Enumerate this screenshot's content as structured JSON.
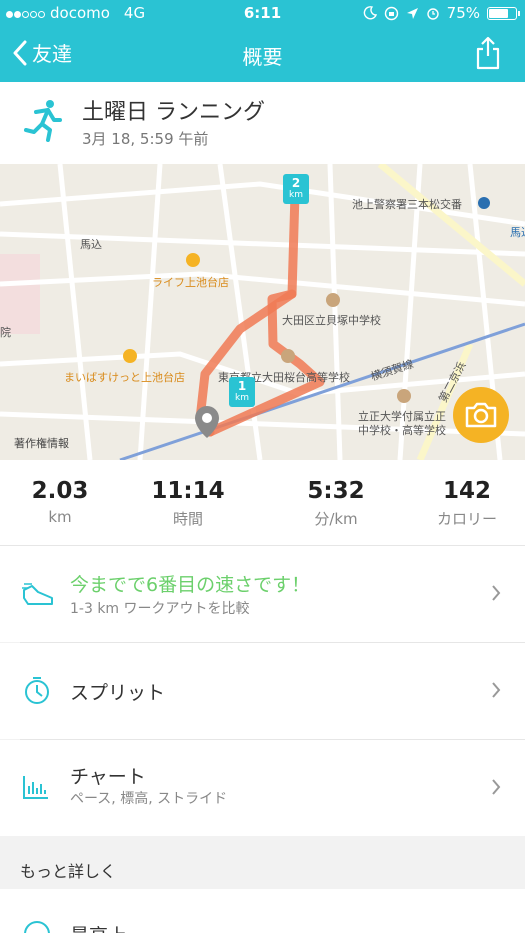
{
  "status_bar": {
    "carrier": "docomo",
    "network": "4G",
    "time": "6:11",
    "battery": "75%",
    "battery_level": 0.75
  },
  "nav": {
    "back_label": "友達",
    "title": "概要"
  },
  "activity": {
    "title": "土曜日 ランニング",
    "date": "3月 18, 5:59 午前"
  },
  "map": {
    "labels": {
      "station": "池上警察署三本松交番",
      "magome": "馬込",
      "umagome_right": "馬込",
      "life": "ライフ上池台店",
      "school1": "大田区立貝塚中学校",
      "school2": "東京都立大田桜台高等学校",
      "maibasu": "まいばすけっと上池台店",
      "yokosuka": "横須賀線",
      "daini": "第二京浜",
      "rissho1": "立正大学付属立正",
      "rissho2": "中学校・高等学校",
      "in": "院",
      "copyright": "著作権情報",
      "km1": "1",
      "km2": "2",
      "km_unit": "km"
    }
  },
  "stats": [
    {
      "value": "2.03",
      "label": "km"
    },
    {
      "value": "11:14",
      "label": "時間"
    },
    {
      "value": "5:32",
      "label": "分/km"
    },
    {
      "value": "142",
      "label": "カロリー"
    }
  ],
  "rows": {
    "compare": {
      "title": "今までで6番目の速さです！",
      "subtitle": "1-3 km ワークアウトを比較"
    },
    "splits": {
      "title": "スプリット"
    },
    "charts": {
      "title": "チャート",
      "subtitle": "ペース, 標高, ストライド"
    }
  },
  "more": {
    "section_label": "もっと詳しく",
    "partial_row": "最高上"
  },
  "colors": {
    "accent": "#2ac3d3",
    "route": "#f07a55",
    "green": "#6cd06c",
    "camera": "#f5b324"
  }
}
